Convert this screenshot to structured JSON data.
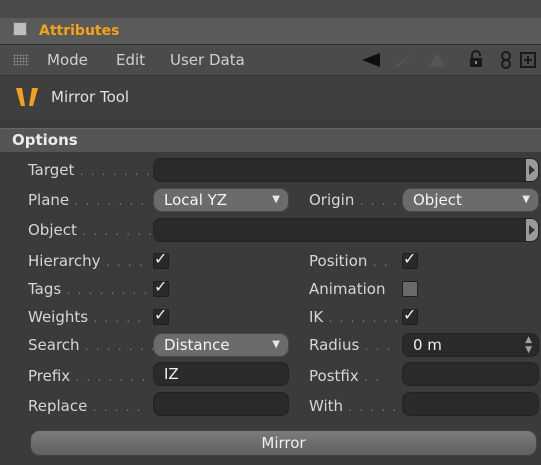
{
  "header": {
    "title": "Attributes"
  },
  "menubar": {
    "items": [
      "Mode",
      "Edit",
      "User Data"
    ],
    "icons": [
      "back-arrow-icon",
      "forward-arrow-icon",
      "up-arrow-icon",
      "lock-icon",
      "link-icon",
      "new-panel-icon"
    ]
  },
  "tool": {
    "name": "Mirror Tool",
    "icon": "mirror-tool-icon"
  },
  "section": {
    "title": "Options"
  },
  "fields": {
    "target": {
      "label": "Target",
      "value": ""
    },
    "plane": {
      "label": "Plane",
      "value": "Local YZ"
    },
    "origin": {
      "label": "Origin",
      "value": "Object"
    },
    "object": {
      "label": "Object",
      "value": ""
    },
    "hierarchy": {
      "label": "Hierarchy",
      "checked": true
    },
    "position": {
      "label": "Position",
      "checked": true
    },
    "tags": {
      "label": "Tags",
      "checked": true
    },
    "animation": {
      "label": "Animation",
      "checked": false
    },
    "weights": {
      "label": "Weights",
      "checked": true
    },
    "ik": {
      "label": "IK",
      "checked": true
    },
    "search": {
      "label": "Search",
      "value": "Distance"
    },
    "radius": {
      "label": "Radius",
      "value": "0 m"
    },
    "prefix": {
      "label": "Prefix",
      "value": "IZ"
    },
    "postfix": {
      "label": "Postfix",
      "value": ""
    },
    "replace": {
      "label": "Replace",
      "value": ""
    },
    "with": {
      "label": "With",
      "value": ""
    }
  },
  "actions": {
    "mirror_label": "Mirror"
  },
  "colors": {
    "accent": "#f4a21a",
    "panel": "#3b3b3b",
    "field": "#2a2a2a",
    "combo": "#6b6b6b"
  }
}
